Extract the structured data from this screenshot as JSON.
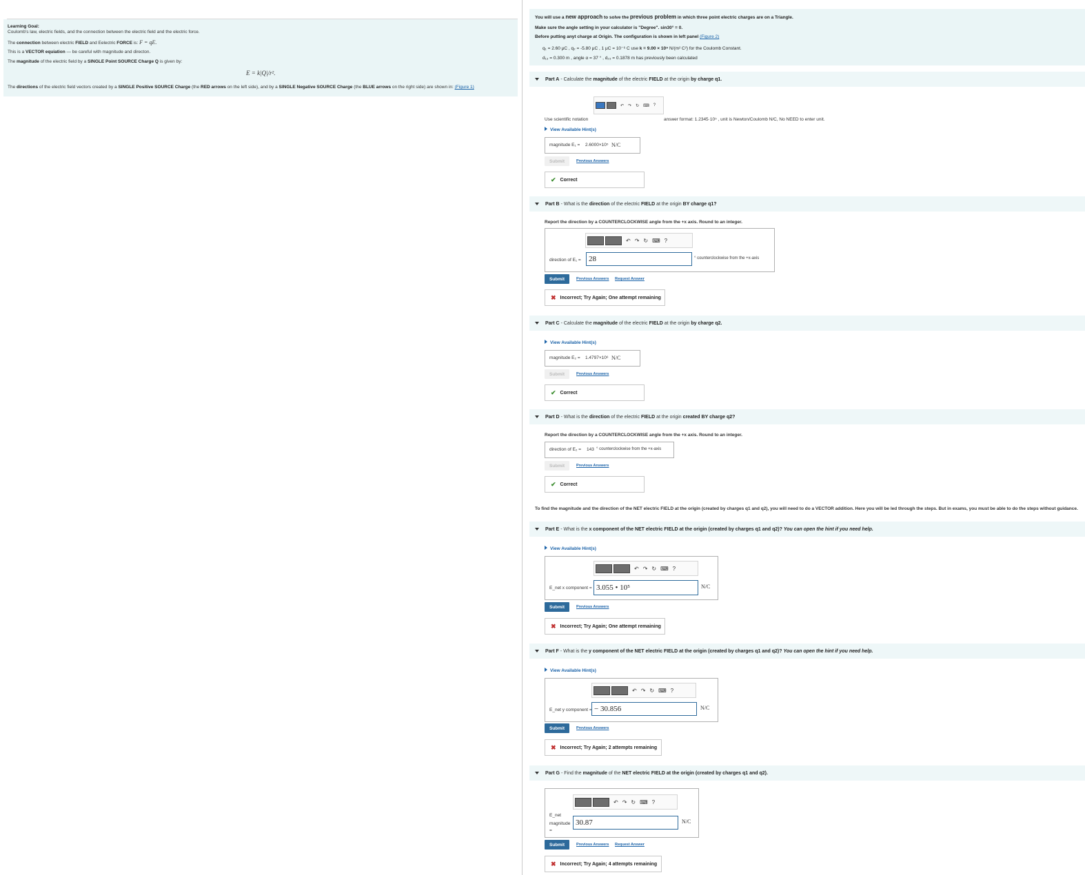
{
  "left": {
    "learning_goal_title": "Learning Goal:",
    "learning_goal_text": "Coulomb's law, electric fields, and the connection between the electric field and the electric force.",
    "connection_prefix": "The",
    "connection_bold1": "connection",
    "connection_mid": "between electric",
    "connection_bold2": "FIELD",
    "connection_and": "and Eelectric",
    "connection_bold3": "FORCE",
    "connection_is": "is:",
    "force_equation": "F = qE.",
    "vector_prefix": "This is a",
    "vector_bold": "VECTOR equiation",
    "vector_suffix": "— be careful with magnitude and directon.",
    "magnitude_prefix": "The",
    "magnitude_bold": "magnitude",
    "magnitude_mid": "of the electric field  by a",
    "magnitude_bold2": "SINGLE Point SOURCE Charge Q",
    "magnitude_suffix": "is given by:",
    "coulomb_formula": "E = k|Q|/r².",
    "directions_text_a": "The",
    "directions_bold_a": "directions",
    "directions_text_b": "of the electric field vectors created by a",
    "directions_bold_b": "SINGLE Positive SOURCE Charge",
    "directions_text_c": "(the",
    "directions_bold_c": "RED arrows",
    "directions_text_d": "on the left side), and by a",
    "directions_bold_d": "SINGLE Negative SOURCE Charge",
    "directions_text_e": "(the",
    "directions_bold_e": "BLUE arrows",
    "directions_text_f": "on the right side) are shown in:",
    "figure1_link": "(Figure 1)"
  },
  "intro": {
    "line1_a": "You will use a",
    "line1_b": "new approach",
    "line1_c": "to solve the",
    "line1_d": "previous problem",
    "line1_e": "in which three point electric charges are on a Triangle.",
    "line2": "Make sure the angle setting in your calculator is \"Degree\". sin30° = 0.",
    "line3_a": "Before putting anyt charge at Origin.  The configuration is shown in  left panel",
    "figure2_link": "(Figure 2)",
    "line4_a": "q₁ = 2.60 μC ,  q₂ = -5.80 μC ,  1 μC = 10⁻⁶ C  use",
    "line4_b": "k = 9.00 × 10⁹",
    "line4_c": "N/(m² C²)  for the Coulomb Constant.",
    "line5": "d₁₃ = 0.300 m ,  angle α = 37 ° ,  d₂₃ = 0.1878 m has previously been calculated"
  },
  "parts": {
    "a": {
      "label": "Part A",
      "text_a": "- Calculate the",
      "text_b": "magnitude",
      "text_c": "of the electric",
      "text_d": "FIELD",
      "text_e": "at the origin",
      "text_f": "by charge q1.",
      "sci_notation": "Use scientific notation",
      "answer_format": "answer format: 1.2345·10⁵ , unit is Newton/Coulomb N/C, No NEED to enter unit.",
      "hint": "View Available Hint(s)",
      "answer_label": "magnitude  E₁ =",
      "answer_value": "2.6000×10⁵",
      "answer_unit": "N/C",
      "submit": "Submit",
      "previous_answers": "Previous Answers",
      "feedback": "Correct"
    },
    "b": {
      "label": "Part B",
      "text_a": "- What is the",
      "text_b": "direction",
      "text_c": "of the electric",
      "text_d": "FIELD",
      "text_e": "at the origin",
      "text_f": "BY charge q1?",
      "instruction": "Report the direction by a COUNTERCLOCKWISE angle from the +x axis. Round to an integer.",
      "answer_label": "direction of E₁ =",
      "answer_value": "28",
      "answer_unit": "° counterclockwise from the +x-axis",
      "submit": "Submit",
      "previous_answers": "Previous Answers",
      "request_answer": "Request Answer",
      "feedback": "Incorrect; Try Again; One attempt remaining"
    },
    "c": {
      "label": "Part C",
      "text_a": "- Calculate the",
      "text_b": "magnitude",
      "text_c": "of the electric",
      "text_d": "FIELD",
      "text_e": "at the origin",
      "text_f": "by charge q2.",
      "hint": "View Available Hint(s)",
      "answer_label": "magnitude  E₂ =",
      "answer_value": "1.4797×10⁶",
      "answer_unit": "N/C",
      "submit": "Submit",
      "previous_answers": "Previous Answers",
      "feedback": "Correct"
    },
    "d": {
      "label": "Part D",
      "text_a": "- What is the",
      "text_b": "direction",
      "text_c": "of the electric",
      "text_d": "FIELD",
      "text_e": "at the origin",
      "text_f": "created BY charge q2?",
      "instruction": "Report the direction by a COUNTERCLOCKWISE angle from the +x axis. Round to an integer.",
      "answer_label": "direction of E₂ =",
      "answer_value": "143",
      "answer_unit": "° counterclockwise from the +x-axis",
      "submit": "Submit",
      "previous_answers": "Previous Answers",
      "feedback": "Correct"
    },
    "net_intro": "To find the magnitude and the direction of the NET electric FIELD at the origin (created by charges q1 and q2), you will need to do a VECTOR addition. Here you will be led through the steps. But in exams, you must be able to do the steps without guidance.",
    "e": {
      "label": "Part E",
      "text_a": "- What is the",
      "text_b": "x component of the NET electric FIELD at the origin (created by charges q1 and q2)?",
      "text_c": "You can open the hint if you need help.",
      "hint": "View Available Hint(s)",
      "answer_label": "E_net x component =",
      "answer_value": "3.055 • 10⁵",
      "answer_unit": "N/C",
      "submit": "Submit",
      "previous_answers": "Previous Answers",
      "feedback": "Incorrect; Try Again; One attempt remaining"
    },
    "f": {
      "label": "Part F",
      "text_a": "- What is the",
      "text_b": "y component of the NET electric FIELD at the origin (created by charges q1 and q2)?",
      "text_c": "You can open the hint if you need help.",
      "hint": "View Available Hint(s)",
      "answer_label": "E_net y component =",
      "answer_value": "− 30.856",
      "answer_unit": "N/C",
      "submit": "Submit",
      "previous_answers": "Previous Answers",
      "feedback": "Incorrect; Try Again; 2 attempts remaining"
    },
    "g": {
      "label": "Part G",
      "text_a": "- Find the",
      "text_b": "magnitude",
      "text_c": "of the",
      "text_d": "NET electric FIELD at the origin (created by charges q1 and q2).",
      "answer_label_1": "E_net",
      "answer_label_2": "magnitude",
      "answer_label_3": "=",
      "answer_value": "30.87",
      "answer_unit": "N/C",
      "submit": "Submit",
      "previous_answers": "Previous Answers",
      "request_answer": "Request Answer",
      "feedback": "Incorrect; Try Again; 4 attempts remaining"
    }
  },
  "icons": {
    "check": "✔",
    "cross": "✖",
    "undo": "↶",
    "redo": "↷",
    "reset": "↻",
    "keyboard": "⌨",
    "help": "?"
  },
  "colors": {
    "panel_bg": "#eaf5f6",
    "link": "#1a62a8",
    "submit_bg": "#2d6a9b",
    "correct": "#3b8d2f",
    "incorrect": "#c03030"
  }
}
